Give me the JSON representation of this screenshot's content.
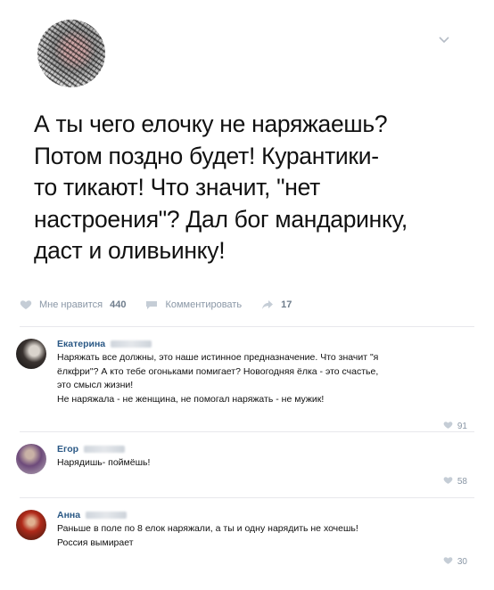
{
  "post": {
    "text_lines": [
      "А ты чего елочку не наряжаешь?",
      "Потом поздно будет! Курантики-",
      "то тикают! Что значит, \"нет",
      "настроения\"? Дал бог мандаринку,",
      "даст и оливьинку!"
    ],
    "actions": {
      "like_label": "Мне нравится",
      "like_count": "440",
      "comment_label": "Комментировать",
      "share_count": "17"
    }
  },
  "comments": [
    {
      "name": "Екатерина",
      "text_lines": [
        "Наряжать все должны, это наше истинное предназначение. Что значит \"я",
        "ёлкфри\"? А кто тебе огоньками помигает? Новогодняя ёлка - это счастье,",
        "это смысл жизни!",
        "Не наряжала - не женщина, не помогал наряжать - не мужик!"
      ],
      "likes": "91"
    },
    {
      "name": "Егор",
      "text_lines": [
        "Нарядишь- поймёшь!"
      ],
      "likes": "58"
    },
    {
      "name": "Анна",
      "text_lines": [
        "Раньше в поле по 8 елок наряжали, а ты и одну нарядить не хочешь!",
        "Россия вымирает"
      ],
      "likes": "30"
    }
  ],
  "colors": {
    "accent": "#2a5885",
    "muted": "#8a97a6",
    "divider": "#e7e8ec"
  }
}
